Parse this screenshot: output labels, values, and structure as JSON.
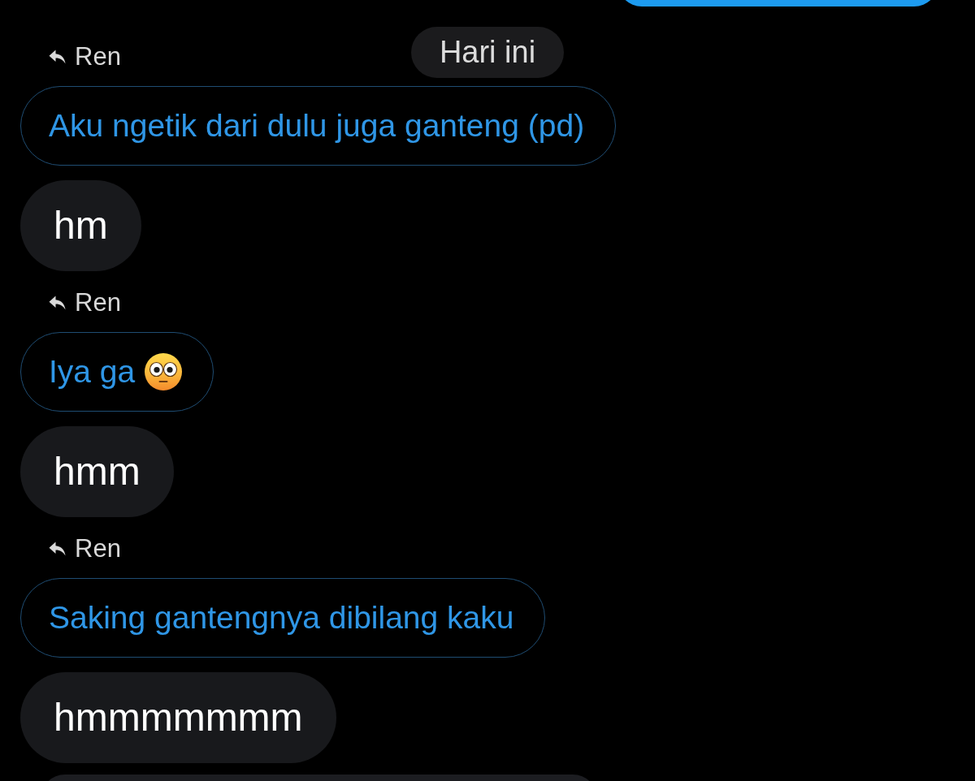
{
  "chat": {
    "date_label": "Hari ini",
    "messages": [
      {
        "kind": "sent"
      },
      {
        "kind": "reply",
        "reply_to": "Ren",
        "quoted": "Aku ngetik dari dulu juga ganteng (pd)",
        "text": "hm"
      },
      {
        "kind": "reply",
        "reply_to": "Ren",
        "quoted": "Iya ga",
        "emoji": true,
        "text": "hmm"
      },
      {
        "kind": "reply",
        "reply_to": "Ren",
        "quoted": "Saking gantengnya dibilang kaku",
        "text": "hmmmmmmm"
      },
      {
        "kind": "received"
      }
    ]
  }
}
